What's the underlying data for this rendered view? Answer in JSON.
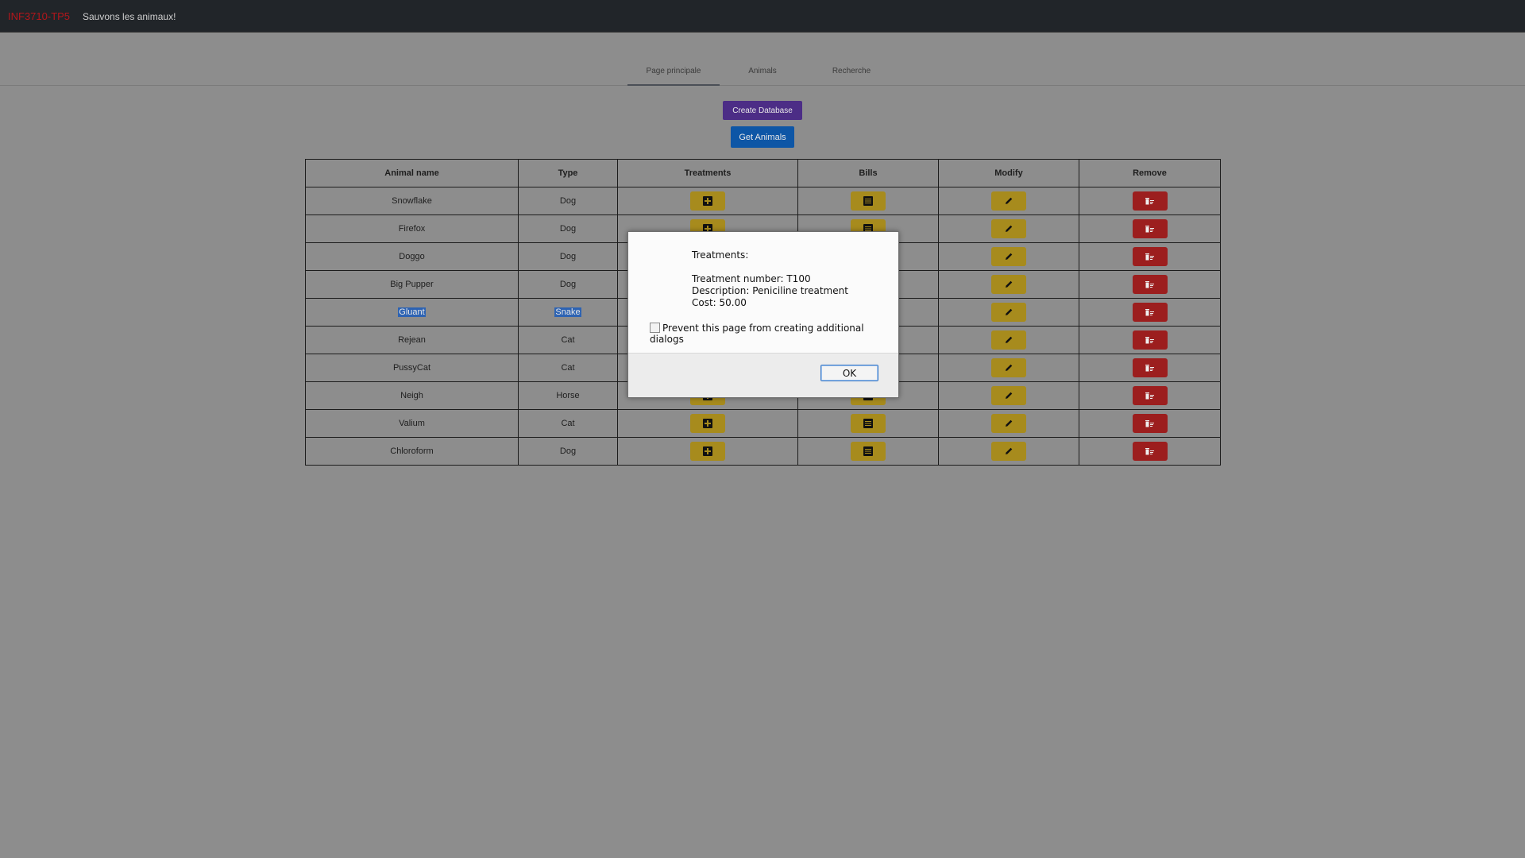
{
  "navbar": {
    "brand": "INF3710-TP5",
    "tagline": "Sauvons les animaux!"
  },
  "tabs": [
    {
      "label": "Page principale",
      "active": true
    },
    {
      "label": "Animals",
      "active": false
    },
    {
      "label": "Recherche",
      "active": false
    }
  ],
  "actions": {
    "create_db": "Create Database",
    "get_animals": "Get Animals"
  },
  "table": {
    "headers": [
      "Animal name",
      "Type",
      "Treatments",
      "Bills",
      "Modify",
      "Remove"
    ],
    "rows": [
      {
        "name": "Snowflake",
        "type": "Dog"
      },
      {
        "name": "Firefox",
        "type": "Dog"
      },
      {
        "name": "Doggo",
        "type": "Dog"
      },
      {
        "name": "Big Pupper",
        "type": "Dog"
      },
      {
        "name": "Gluant",
        "type": "Snake",
        "selected": true
      },
      {
        "name": "Rejean",
        "type": "Cat"
      },
      {
        "name": "PussyCat",
        "type": "Cat"
      },
      {
        "name": "Neigh",
        "type": "Horse"
      },
      {
        "name": "Valium",
        "type": "Cat"
      },
      {
        "name": "Chloroform",
        "type": "Dog"
      }
    ]
  },
  "dialog": {
    "title": "Treatments:",
    "line1": "Treatment number: T100",
    "line2": "Description: Peniciline treatment",
    "line3": "Cost: 50.00",
    "prevent_label": "Prevent this page from creating additional dialogs",
    "ok_label": "OK"
  },
  "colors": {
    "brand": "#b3161b",
    "create_db": "#4c2d86",
    "get_animals": "#0d56a6",
    "action_yellow": "#a78b1d",
    "action_red": "#9c1e1e",
    "selection": "#2d63b3"
  }
}
